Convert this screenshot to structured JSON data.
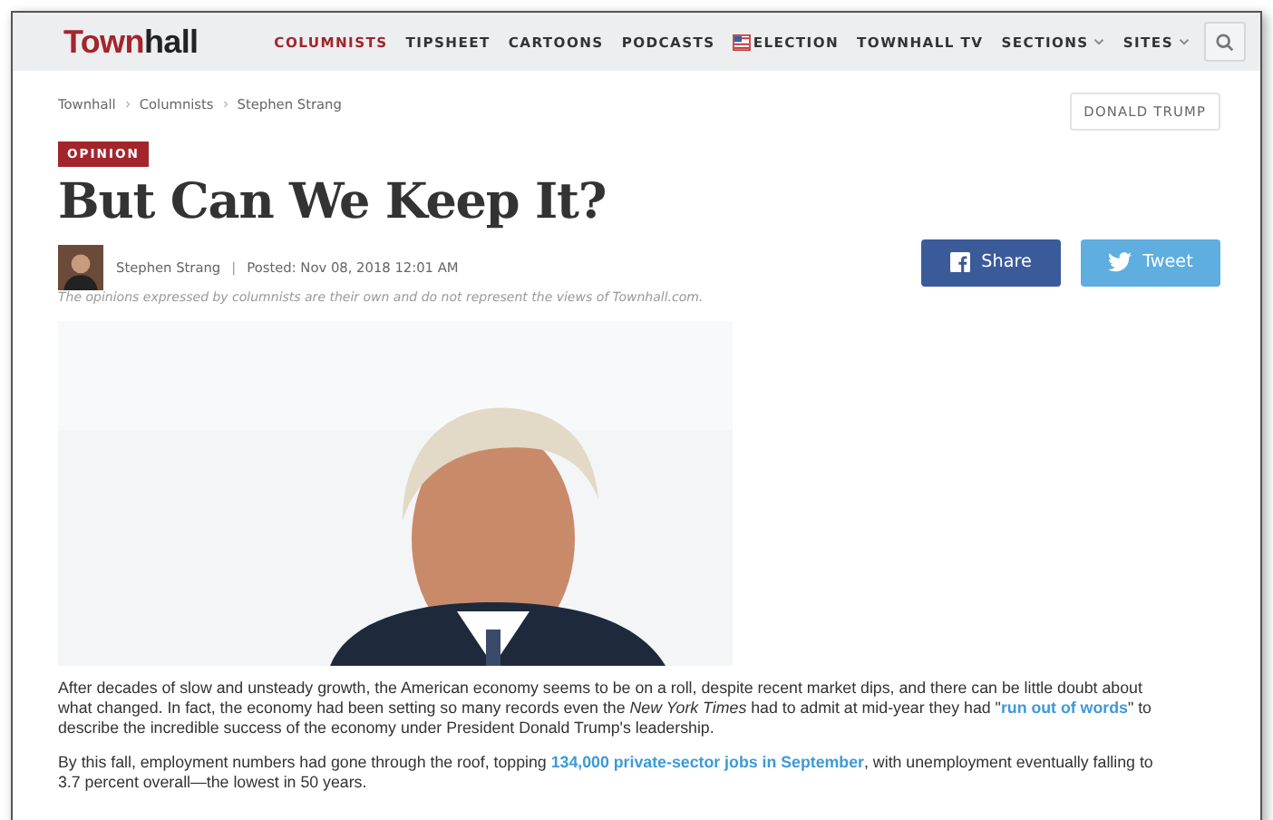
{
  "header": {
    "logo": {
      "part1": "Town",
      "part2": "hall"
    },
    "nav": [
      {
        "label": "COLUMNISTS",
        "selected": true,
        "kind": "plain"
      },
      {
        "label": "TIPSHEET",
        "selected": false,
        "kind": "plain"
      },
      {
        "label": "CARTOONS",
        "selected": false,
        "kind": "plain"
      },
      {
        "label": "PODCASTS",
        "selected": false,
        "kind": "plain"
      },
      {
        "label": "ELECTION",
        "selected": false,
        "kind": "flag"
      },
      {
        "label": "TOWNHALL TV",
        "selected": false,
        "kind": "plain"
      },
      {
        "label": "SECTIONS",
        "selected": false,
        "kind": "menu"
      },
      {
        "label": "SITES",
        "selected": false,
        "kind": "menu"
      }
    ]
  },
  "breadcrumbs": [
    "Townhall",
    "Columnists",
    "Stephen Strang"
  ],
  "topic_tag": "DONALD TRUMP",
  "category": "OPINION",
  "title": "But Can We Keep It?",
  "byline": {
    "author": "Stephen Strang",
    "separator": "|",
    "posted": "Posted: Nov 08, 2018 12:01 AM"
  },
  "share": {
    "facebook": "Share",
    "twitter": "Tweet"
  },
  "disclaimer": "The opinions expressed by columnists are their own and do not represent the views of Townhall.com.",
  "paragraphs": [
    [
      {
        "kind": "text",
        "text": "After decades of slow and unsteady growth, the American economy seems to be on a roll, despite recent market dips, and there can be little doubt about what changed. In fact, the economy had been setting so many records even the "
      },
      {
        "kind": "italic",
        "text": "New York Times"
      },
      {
        "kind": "text",
        "text": " had to admit at mid-year they had \""
      },
      {
        "kind": "link",
        "text": "run out of words"
      },
      {
        "kind": "text",
        "text": "\" to describe the incredible success of the economy under President Donald Trump's leadership."
      }
    ],
    [
      {
        "kind": "text",
        "text": "By this fall, employment numbers had gone through the roof, topping "
      },
      {
        "kind": "link",
        "text": "134,000 private-sector jobs in September"
      },
      {
        "kind": "text",
        "text": ", with unemployment eventually falling to 3.7 percent overall—the lowest in 50 years."
      }
    ]
  ]
}
